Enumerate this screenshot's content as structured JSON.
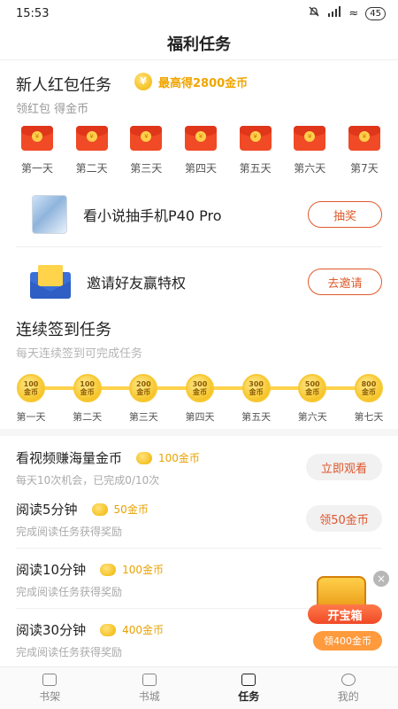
{
  "status_bar": {
    "time": "15:53",
    "wifi": "≈",
    "battery": "45"
  },
  "page_title": "福利任务",
  "newbie": {
    "title": "新人红包任务",
    "highlight": "最高得2800金币",
    "coin_glyph": "¥",
    "subtitle": "领红包 得金币",
    "packet_glyph": "¥",
    "days": [
      "第一天",
      "第二天",
      "第三天",
      "第四天",
      "第五天",
      "第六天",
      "第7天"
    ]
  },
  "promos": [
    {
      "text": "看小说抽手机P40 Pro",
      "button": "抽奖"
    },
    {
      "text": "邀请好友赢特权",
      "button": "去邀请"
    }
  ],
  "signin": {
    "title": "连续签到任务",
    "subtitle": "每天连续签到可完成任务",
    "coin_unit": "金币",
    "days": [
      {
        "amount": "100",
        "label": "第一天"
      },
      {
        "amount": "100",
        "label": "第二天"
      },
      {
        "amount": "200",
        "label": "第三天"
      },
      {
        "amount": "300",
        "label": "第四天"
      },
      {
        "amount": "300",
        "label": "第五天"
      },
      {
        "amount": "500",
        "label": "第六天"
      },
      {
        "amount": "800",
        "label": "第七天"
      }
    ]
  },
  "tasks": [
    {
      "title": "看视频赚海量金币",
      "reward": "100金币",
      "desc": "每天10次机会，已完成0/10次",
      "button": "立即观看"
    },
    {
      "title": "阅读5分钟",
      "reward": "50金币",
      "desc": "完成阅读任务获得奖励",
      "button": "领50金币"
    },
    {
      "title": "阅读10分钟",
      "reward": "100金币",
      "desc": "完成阅读任务获得奖励",
      "button": ""
    },
    {
      "title": "阅读30分钟",
      "reward": "400金币",
      "desc": "完成阅读任务获得奖励",
      "button": ""
    }
  ],
  "treasure": {
    "close": "×",
    "label": "开宝箱",
    "pill": "领400金币"
  },
  "tabs": [
    {
      "label": "书架",
      "active": false
    },
    {
      "label": "书城",
      "active": false
    },
    {
      "label": "任务",
      "active": true
    },
    {
      "label": "我的",
      "active": false
    }
  ],
  "colors": {
    "accent": "#e05a2a",
    "gold": "#f0a500",
    "red_packet": "#f04a26"
  }
}
